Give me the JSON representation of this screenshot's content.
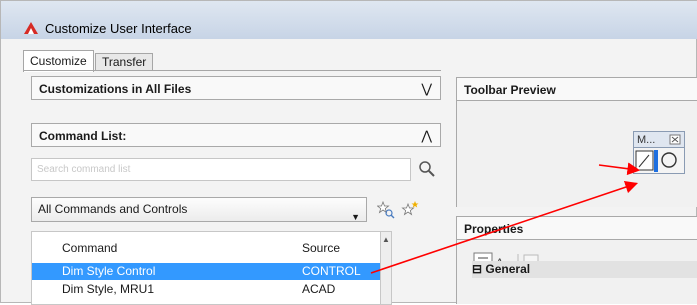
{
  "window": {
    "title": "Customize User Interface"
  },
  "tabs": [
    {
      "label": "Customize"
    },
    {
      "label": "Transfer"
    }
  ],
  "left": {
    "customizations_header": "Customizations in All Files",
    "command_list_header": "Command List:",
    "search_placeholder": "Search command list",
    "filter_value": "All Commands and Controls",
    "table": {
      "columns": [
        "Command",
        "Source"
      ],
      "rows": [
        {
          "command": "Dim Style Control",
          "source": "CONTROL",
          "selected": true
        },
        {
          "command": "Dim Style, MRU1",
          "source": "ACAD",
          "selected": false
        }
      ]
    }
  },
  "right": {
    "toolbar_preview_header": "Toolbar Preview",
    "mini_toolbar_title": "M...",
    "properties_header": "Properties",
    "general_section": "General"
  },
  "icons": {
    "expand": "double-chevron-down",
    "collapse": "double-chevron-up",
    "search": "magnifier",
    "new_command": "star-magnifier",
    "new_control": "star-plus"
  },
  "colors": {
    "selection": "#3399ff",
    "annotation_arrow": "#ff0000",
    "app_icon": "#d62b25"
  }
}
